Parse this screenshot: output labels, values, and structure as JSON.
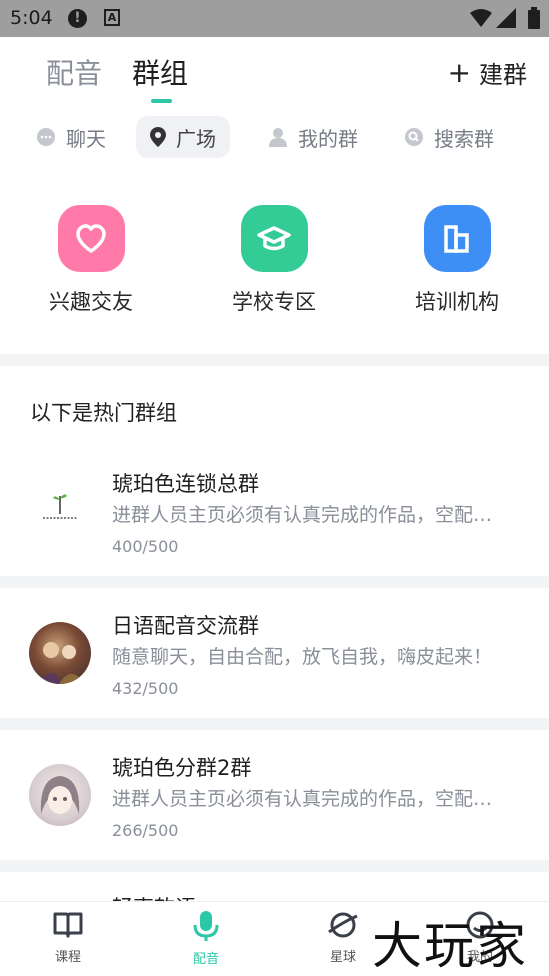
{
  "status_bar": {
    "time": "5:04"
  },
  "header": {
    "tabs": [
      {
        "label": "配音",
        "active": false
      },
      {
        "label": "群组",
        "active": true
      }
    ],
    "create_label": "建群"
  },
  "sub_tabs": [
    {
      "label": "聊天",
      "icon": "chat-bubble-icon",
      "selected": false
    },
    {
      "label": "广场",
      "icon": "location-pin-icon",
      "selected": true
    },
    {
      "label": "我的群",
      "icon": "person-icon",
      "selected": false
    },
    {
      "label": "搜索群",
      "icon": "search-icon",
      "selected": false
    }
  ],
  "categories": [
    {
      "label": "兴趣交友",
      "icon": "heart-icon",
      "color": "#ff7aa8"
    },
    {
      "label": "学校专区",
      "icon": "graduation-cap-icon",
      "color": "#33cc96"
    },
    {
      "label": "培训机构",
      "icon": "building-icon",
      "color": "#3d8ef5"
    }
  ],
  "section_title": "以下是热门群组",
  "groups": [
    {
      "name": "琥珀色连锁总群",
      "desc": "进群人员主页必须有认真完成的作品，空配…",
      "count": "400/500"
    },
    {
      "name": "日语配音交流群",
      "desc": "随意聊天，自由合配，放飞自我，嗨皮起来！",
      "count": "432/500"
    },
    {
      "name": "琥珀色分群2群",
      "desc": "进群人员主页必须有认真完成的作品，空配…",
      "count": "266/500"
    },
    {
      "name": "轻声软语"
    }
  ],
  "bottom_nav": [
    {
      "label": "课程",
      "icon": "book-icon",
      "active": false
    },
    {
      "label": "配音",
      "icon": "microphone-icon",
      "active": true
    },
    {
      "label": "星球",
      "icon": "planet-icon",
      "active": false
    },
    {
      "label": "我的",
      "icon": "profile-icon",
      "active": false
    }
  ],
  "watermark": "大玩家",
  "colors": {
    "accent": "#2cc7a7",
    "text_muted": "#8a8f99"
  }
}
